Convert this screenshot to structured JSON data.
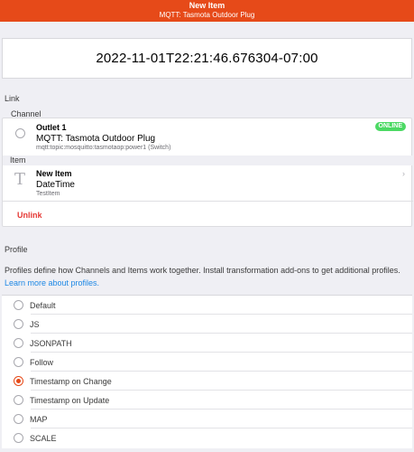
{
  "header": {
    "title": "New Item",
    "subtitle": "MQTT: Tasmota Outdoor Plug"
  },
  "state": {
    "value": "2022-11-01T22:21:46.676304-07:00"
  },
  "link": {
    "section_label": "Link",
    "channel_label": "Channel",
    "channel": {
      "title": "Outlet 1",
      "thing": "MQTT: Tasmota Outdoor Plug",
      "uid": "mqtt:topic:mosquitto:tasmotaop:power1 (Switch)",
      "status": "ONLINE"
    },
    "item_label": "Item",
    "item": {
      "icon_letter": "T",
      "title": "New Item",
      "type": "DateTime",
      "name": "TestItem"
    },
    "unlink_label": "Unlink"
  },
  "profile": {
    "section_label": "Profile",
    "description": "Profiles define how Channels and Items work together. Install transformation add-ons to get additional profiles.",
    "learn_more": "Learn more about profiles.",
    "options": [
      {
        "label": "Default",
        "checked": false
      },
      {
        "label": "JS",
        "checked": false
      },
      {
        "label": "JSONPATH",
        "checked": false
      },
      {
        "label": "Follow",
        "checked": false
      },
      {
        "label": "Timestamp on Change",
        "checked": true
      },
      {
        "label": "Timestamp on Update",
        "checked": false
      },
      {
        "label": "MAP",
        "checked": false
      },
      {
        "label": "SCALE",
        "checked": false
      }
    ]
  },
  "colors": {
    "accent": "#e64a19",
    "online": "#4cd964",
    "link": "#1e88e5",
    "danger": "#e53935"
  }
}
